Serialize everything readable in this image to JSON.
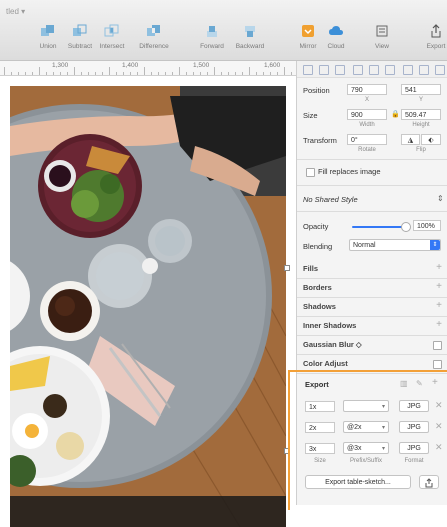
{
  "app": {
    "doc_title": "tled ▾"
  },
  "toolbar": {
    "buttons": [
      {
        "label": "Union"
      },
      {
        "label": "Subtract"
      },
      {
        "label": "Intersect"
      },
      {
        "label": "Difference"
      },
      {
        "label": "Forward"
      },
      {
        "label": "Backward"
      },
      {
        "label": "Mirror"
      },
      {
        "label": "Cloud"
      },
      {
        "label": "View"
      },
      {
        "label": "Export"
      }
    ]
  },
  "ruler": {
    "labels": [
      "1,300",
      "1,400",
      "1,500",
      "1,600"
    ]
  },
  "inspector": {
    "position": {
      "label": "Position",
      "x": "790",
      "y": "541",
      "x_sub": "X",
      "y_sub": "Y"
    },
    "size": {
      "label": "Size",
      "width": "900",
      "height": "509.47",
      "w_sub": "Width",
      "h_sub": "Height"
    },
    "transform": {
      "label": "Transform",
      "rotate": "0°",
      "r_sub": "Rotate",
      "f_sub": "Flip"
    },
    "fill_replaces": "Fill replaces image",
    "shared_style": "No Shared Style",
    "opacity": {
      "label": "Opacity",
      "value": "100%",
      "level": 1.0
    },
    "blending": {
      "label": "Blending",
      "value": "Normal"
    },
    "sections": [
      "Fills",
      "Borders",
      "Shadows",
      "Inner Shadows",
      "Gaussian Blur ◇",
      "Color Adjust"
    ],
    "export": {
      "title": "Export",
      "rows": [
        {
          "size": "1x",
          "suffix": "",
          "format": "JPG"
        },
        {
          "size": "2x",
          "suffix": "@2x",
          "format": "JPG"
        },
        {
          "size": "3x",
          "suffix": "@3x",
          "format": "JPG"
        }
      ],
      "col_size": "Size",
      "col_suffix": "Prefix/Suffix",
      "col_format": "Format",
      "button": "Export table-sketch..."
    }
  },
  "colors": {
    "accent": "#3478f6",
    "highlight": "#f3a038",
    "toolbar_icon": "#7bb3d8"
  }
}
